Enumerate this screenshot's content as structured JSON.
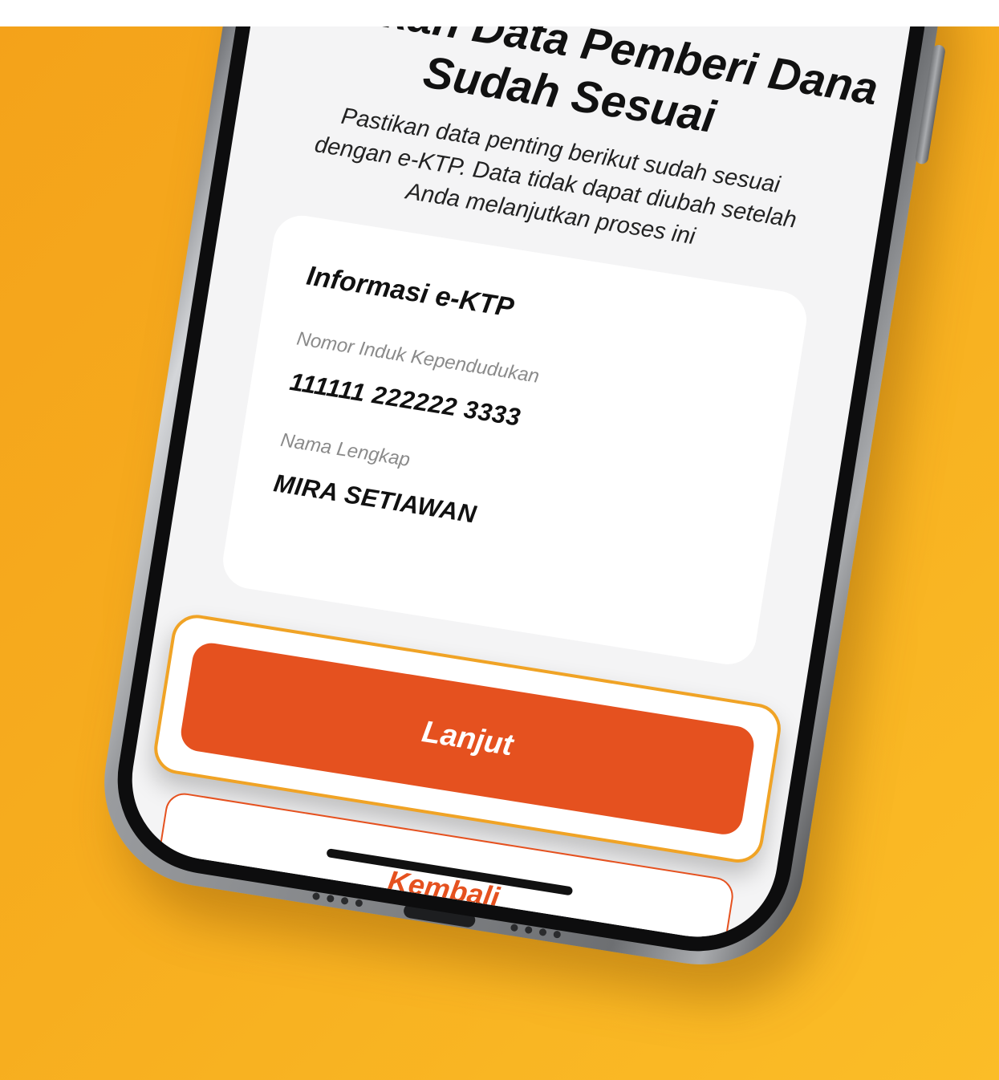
{
  "screen": {
    "title": "Pastikan Data Pemberi Dana Sudah Sesuai",
    "description": "Pastikan data penting berikut sudah sesuai dengan e-KTP. Data tidak dapat diubah setelah Anda melanjutkan proses ini"
  },
  "card": {
    "title": "Informasi e-KTP",
    "fields": [
      {
        "label": "Nomor Induk Kependudukan",
        "value": "111111 222222 3333"
      },
      {
        "label": "Nama Lengkap",
        "value": "MIRA SETIAWAN"
      }
    ]
  },
  "buttons": {
    "primary_label": "Lanjut",
    "secondary_label": "Kembali"
  },
  "colors": {
    "background": "#f7ae1f",
    "primary": "#e5511f",
    "highlight_border": "#f0a325",
    "screen_bg": "#f4f4f5"
  }
}
